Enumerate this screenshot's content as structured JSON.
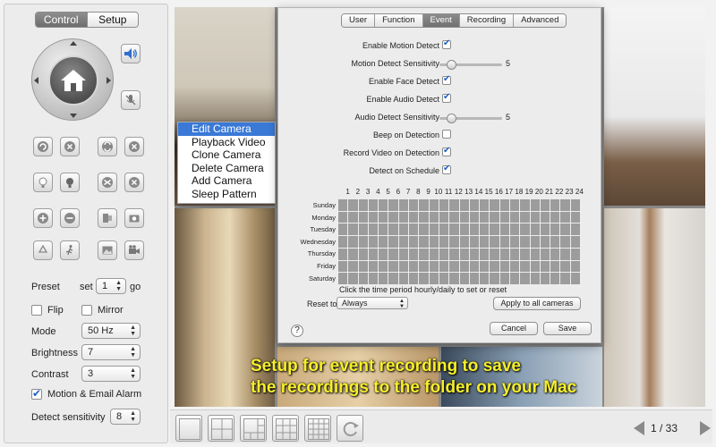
{
  "sidebar": {
    "tabs": {
      "control": "Control",
      "setup": "Setup"
    },
    "preset": {
      "label": "Preset",
      "set_label": "set",
      "value": "1",
      "go_label": "go"
    },
    "flip_label": "Flip",
    "flip_checked": false,
    "mirror_label": "Mirror",
    "mirror_checked": false,
    "mode": {
      "label": "Mode",
      "value": "50 Hz"
    },
    "brightness": {
      "label": "Brightness",
      "value": "7"
    },
    "contrast": {
      "label": "Contrast",
      "value": "3"
    },
    "alarm": {
      "label": "Motion & Email Alarm",
      "checked": true
    },
    "sensitivity": {
      "label": "Detect sensitivity",
      "value": "8"
    }
  },
  "context_menu": {
    "items": [
      "Edit Camera",
      "Playback Video",
      "Clone Camera",
      "Delete Camera",
      "Add Camera",
      "Sleep Pattern"
    ],
    "highlighted": "Edit Camera"
  },
  "dialog": {
    "tabs": [
      "User",
      "Function",
      "Event",
      "Recording",
      "Advanced"
    ],
    "active_tab": "Event",
    "options": [
      {
        "label": "Enable Motion Detect",
        "type": "checkbox",
        "checked": true
      },
      {
        "label": "Motion Detect Sensitivity",
        "type": "slider",
        "value": "5"
      },
      {
        "label": "Enable Face Detect",
        "type": "checkbox",
        "checked": true
      },
      {
        "label": "Enable Audio Detect",
        "type": "checkbox",
        "checked": true
      },
      {
        "label": "Audio Detect Sensitivity",
        "type": "slider",
        "value": "5"
      },
      {
        "label": "Beep on Detection",
        "type": "checkbox",
        "checked": false
      },
      {
        "label": "Record Video on Detection",
        "type": "checkbox",
        "checked": true
      },
      {
        "label": "Detect on Schedule",
        "type": "checkbox",
        "checked": true
      }
    ],
    "hours": [
      "1",
      "2",
      "3",
      "4",
      "5",
      "6",
      "7",
      "8",
      "9",
      "10",
      "11",
      "12",
      "13",
      "14",
      "15",
      "16",
      "17",
      "18",
      "19",
      "20",
      "21",
      "22",
      "23",
      "24"
    ],
    "days": [
      "Sunday",
      "Monday",
      "Tuesday",
      "Wednesday",
      "Thursday",
      "Friday",
      "Saturday"
    ],
    "schedule_hint": "Click the time period hourly/daily to set or reset",
    "reset_label": "Reset to",
    "reset_value": "Always",
    "apply_all_label": "Apply to all cameras",
    "help_label": "?",
    "cancel_label": "Cancel",
    "save_label": "Save"
  },
  "overlay": {
    "line1": "Setup for event recording to save",
    "line2": "the recordings to the folder on your Mac",
    "color": "#f6ef2a"
  },
  "pager": {
    "label": "1 / 33"
  },
  "colors": {
    "accent": "#3a79d6",
    "check": "#1f5fc4"
  }
}
